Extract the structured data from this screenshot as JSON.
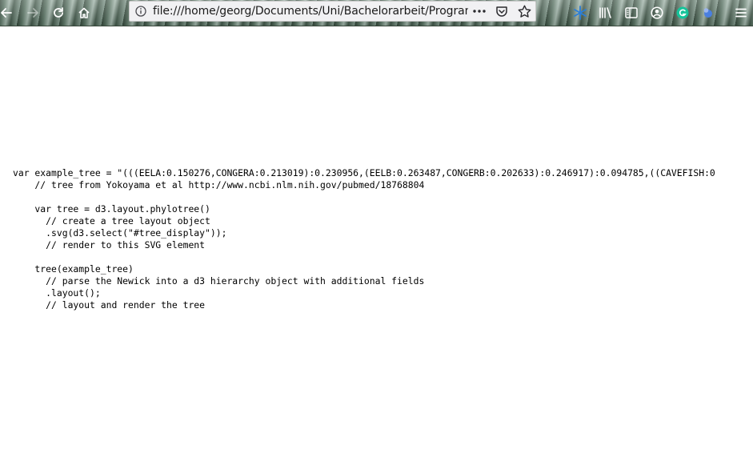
{
  "browser": {
    "url": "file:///home/georg/Documents/Uni/Bachelorarbeit/Program",
    "icons": {
      "back": "back-arrow-icon",
      "forward": "forward-arrow-icon",
      "reload": "reload-icon",
      "home": "home-icon",
      "info": "info-icon",
      "more": "more-dots-icon",
      "pocket": "pocket-icon",
      "bookmark": "star-icon",
      "extension": "extension-icon",
      "library": "library-icon",
      "sidebar": "sidebar-icon",
      "account": "account-icon",
      "grammarly": "grammarly-icon",
      "extension2": "extension-icon",
      "menu": "hamburger-menu-icon"
    }
  },
  "code": {
    "lines": [
      "var example_tree = \"(((EELA:0.150276,CONGERA:0.213019):0.230956,(EELB:0.263487,CONGERB:0.202633):0.246917):0.094785,((CAVEFISH:0",
      "    // tree from Yokoyama et al http://www.ncbi.nlm.nih.gov/pubmed/18768804",
      "",
      "    var tree = d3.layout.phylotree()",
      "      // create a tree layout object",
      "      .svg(d3.select(\"#tree_display\"));",
      "      // render to this SVG element",
      "",
      "    tree(example_tree)",
      "      // parse the Newick into a d3 hierarchy object with additional fields",
      "      .layout();",
      "      // layout and render the tree"
    ]
  }
}
